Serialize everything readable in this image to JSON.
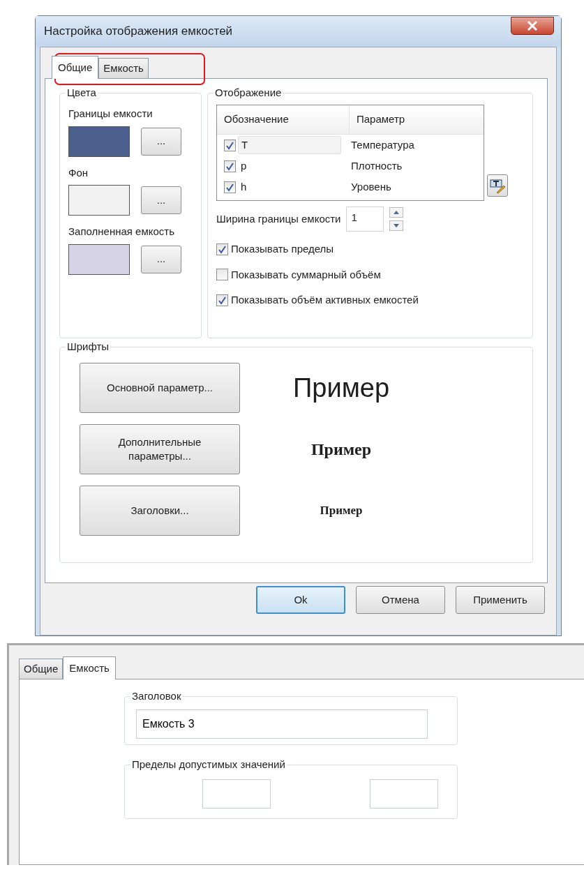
{
  "dialog": {
    "title": "Настройка отображения емкостей",
    "tabs_highlighted": true,
    "tabs": [
      {
        "label": "Общие",
        "selected": true
      },
      {
        "label": "Емкость",
        "selected": false
      }
    ],
    "colors": {
      "title": "Цвета",
      "items": [
        {
          "label": "Границы емкости",
          "color": "#4a5f8c",
          "button": "..."
        },
        {
          "label": "Фон",
          "color": "#f2f2f2",
          "button": "..."
        },
        {
          "label": "Заполненная емкость",
          "color": "#d6d2e8",
          "button": "..."
        }
      ]
    },
    "display": {
      "title": "Отображение",
      "columns": [
        "Обозначение",
        "Параметр"
      ],
      "rows": [
        {
          "checked": true,
          "symbol": "T",
          "parameter": "Температура",
          "selected": true
        },
        {
          "checked": true,
          "symbol": "p",
          "parameter": "Плотность",
          "selected": false
        },
        {
          "checked": true,
          "symbol": "h",
          "parameter": "Уровень",
          "selected": false
        }
      ],
      "border_width": {
        "label": "Ширина границы емкости",
        "value": "1"
      },
      "options": [
        {
          "label": "Показывать пределы",
          "checked": true
        },
        {
          "label": "Показывать суммарный объём",
          "checked": false
        },
        {
          "label": "Показывать объём активных емкостей",
          "checked": true
        }
      ]
    },
    "fonts": {
      "title": "Шрифты",
      "items": [
        {
          "button": "Основной параметр...",
          "sample": "Пример",
          "kind": "large-sans"
        },
        {
          "button": "Дополнительные параметры...",
          "sample": "Пример",
          "kind": "bold-serif"
        },
        {
          "button": "Заголовки...",
          "sample": "Пример",
          "kind": "bold-small"
        }
      ]
    },
    "buttons": [
      {
        "label": "Ok",
        "default": true
      },
      {
        "label": "Отмена",
        "default": false
      },
      {
        "label": "Применить",
        "default": false
      }
    ]
  },
  "second_view": {
    "tabs": [
      {
        "label": "Общие",
        "selected": false
      },
      {
        "label": "Емкость",
        "selected": true
      }
    ],
    "header_group": {
      "title": "Заголовок",
      "value": "Емкость 3"
    },
    "limits_group": {
      "title": "Пределы допустимых значений"
    }
  }
}
